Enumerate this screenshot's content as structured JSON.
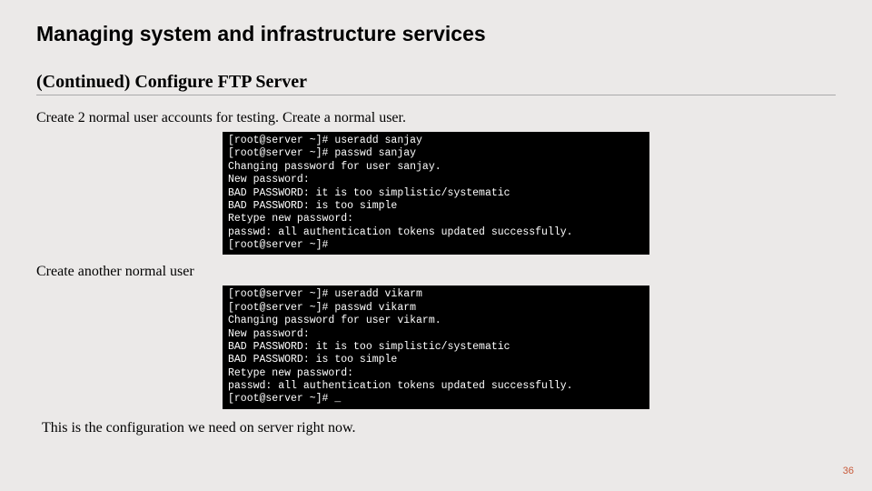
{
  "title": "Managing system and infrastructure services",
  "section_heading": "(Continued) Configure FTP Server",
  "body_text_1": "Create 2 normal user accounts for testing. Create a normal user.",
  "terminal_1_lines": [
    "[root@server ~]# useradd sanjay",
    "[root@server ~]# passwd sanjay",
    "Changing password for user sanjay.",
    "New password:",
    "BAD PASSWORD: it is too simplistic/systematic",
    "BAD PASSWORD: is too simple",
    "Retype new password:",
    "passwd: all authentication tokens updated successfully.",
    "[root@server ~]#"
  ],
  "body_text_2": "Create another normal user",
  "terminal_2_lines": [
    "[root@server ~]# useradd vikarm",
    "[root@server ~]# passwd vikarm",
    "Changing password for user vikarm.",
    "New password:",
    "BAD PASSWORD: it is too simplistic/systematic",
    "BAD PASSWORD: is too simple",
    "Retype new password:",
    "passwd: all authentication tokens updated successfully.",
    "[root@server ~]# _"
  ],
  "footer_text": "This is the configuration we need on server right now.",
  "page_number": "36"
}
